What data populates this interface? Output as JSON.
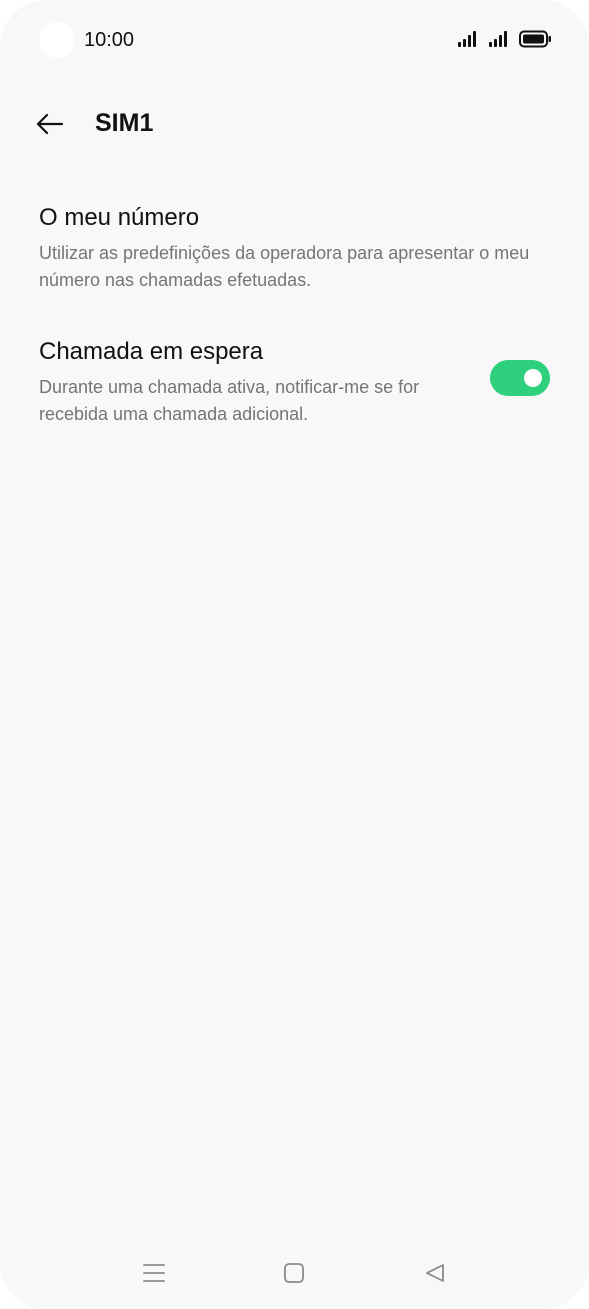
{
  "status_bar": {
    "time": "10:00",
    "icons": [
      "camera-cutout",
      "signal-icon",
      "signal-icon",
      "battery-icon"
    ]
  },
  "header": {
    "back_icon": "arrow-left-icon",
    "title": "SIM1"
  },
  "settings": [
    {
      "title": "O meu número",
      "description": "Utilizar as predefinições da operadora para apresentar o meu número nas chamadas efetuadas."
    },
    {
      "title": "Chamada em espera",
      "description": "Durante uma chamada ativa, notificar-me se for recebida uma chamada adicional.",
      "toggle_on": true
    }
  ],
  "nav_bar": {
    "icons": [
      "menu-icon",
      "home-icon",
      "back-triangle-icon"
    ]
  },
  "colors": {
    "background": "#f8f8f8",
    "toggle_active": "#2ecf7d",
    "secondary_text": "#757575"
  }
}
